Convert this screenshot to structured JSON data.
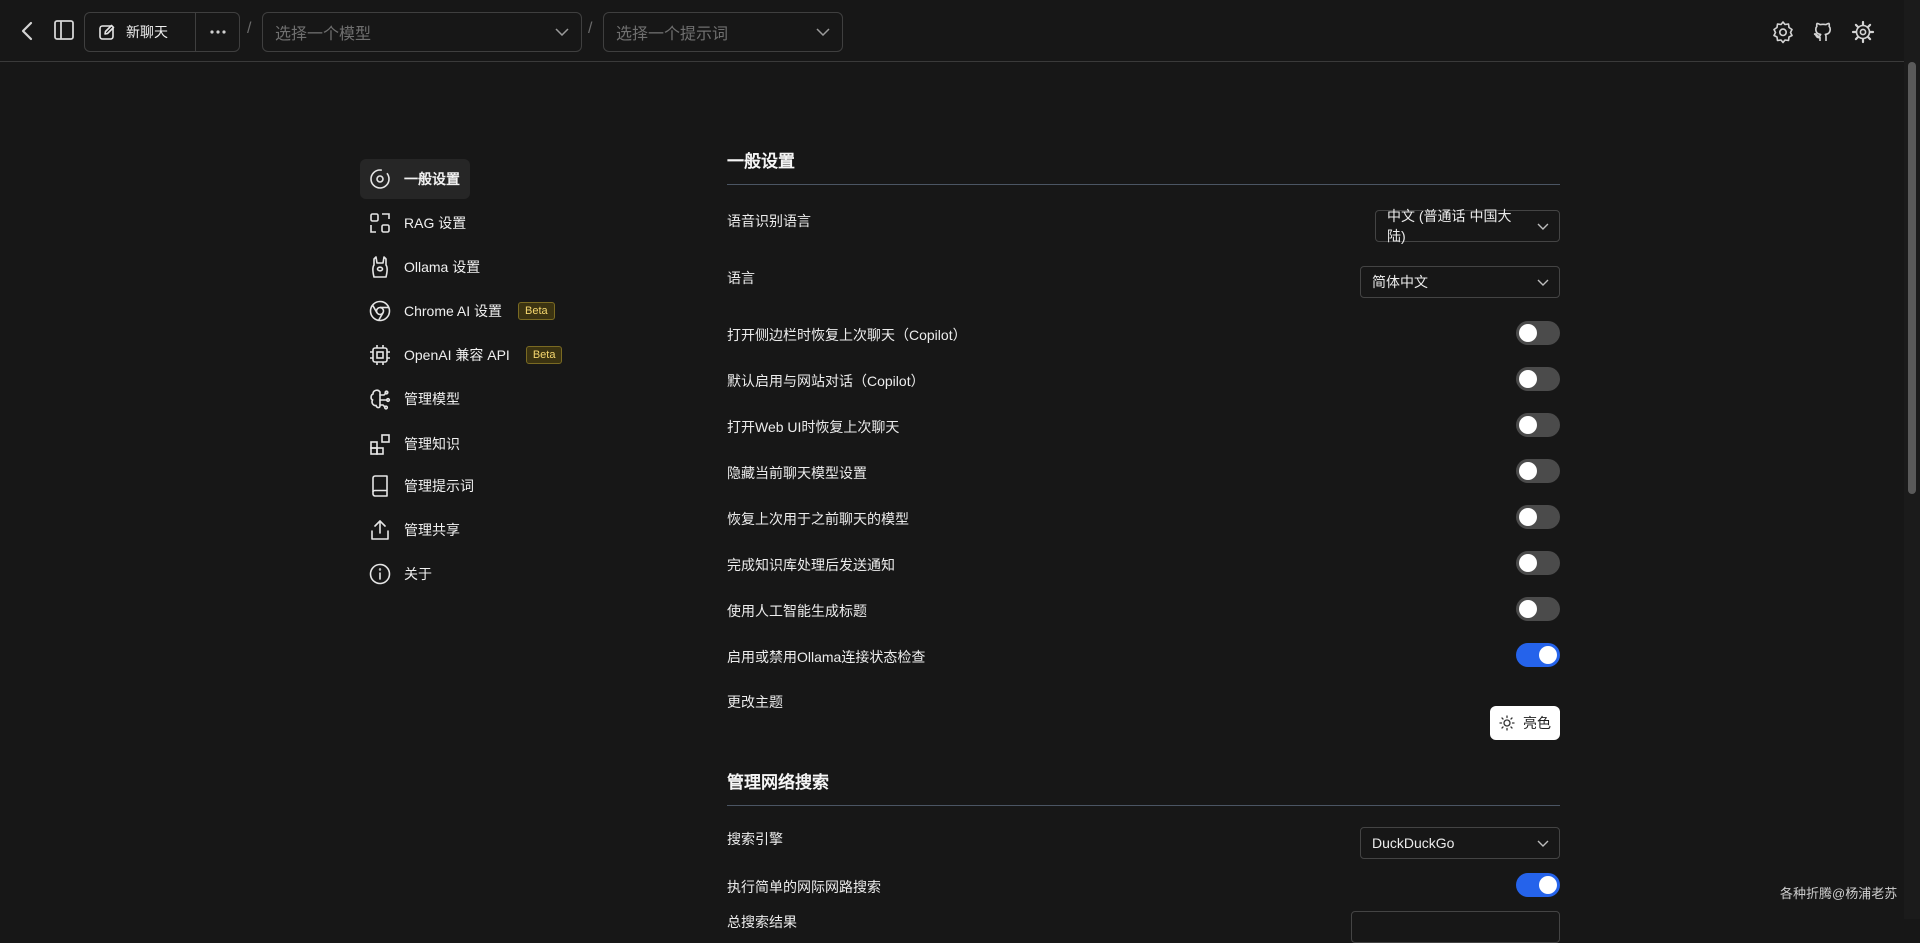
{
  "topbar": {
    "new_chat_label": "新聊天",
    "model_placeholder": "选择一个模型",
    "prompt_placeholder": "选择一个提示词",
    "separator": "/"
  },
  "sidebar": {
    "items": [
      {
        "label": "一般设置",
        "icon": "gear-circle-icon",
        "active": true
      },
      {
        "label": "RAG 设置",
        "icon": "scan-icon"
      },
      {
        "label": "Ollama 设置",
        "icon": "llama-icon"
      },
      {
        "label": "Chrome AI 设置",
        "icon": "chrome-icon",
        "badge": "Beta"
      },
      {
        "label": "OpenAI 兼容 API",
        "icon": "cpu-icon",
        "badge": "Beta"
      },
      {
        "label": "管理模型",
        "icon": "brain-icon"
      },
      {
        "label": "管理知识",
        "icon": "blocks-icon"
      },
      {
        "label": "管理提示词",
        "icon": "book-icon"
      },
      {
        "label": "管理共享",
        "icon": "share-icon"
      },
      {
        "label": "关于",
        "icon": "info-icon"
      }
    ]
  },
  "general": {
    "title": "一般设置",
    "speech_language_label": "语音识别语言",
    "speech_language_value": "中文 (普通话 中国大陆)",
    "language_label": "语言",
    "language_value": "简体中文",
    "toggles": [
      {
        "label": "打开侧边栏时恢复上次聊天（Copilot）",
        "on": false
      },
      {
        "label": "默认启用与网站对话（Copilot）",
        "on": false
      },
      {
        "label": "打开Web UI时恢复上次聊天",
        "on": false
      },
      {
        "label": "隐藏当前聊天模型设置",
        "on": false
      },
      {
        "label": "恢复上次用于之前聊天的模型",
        "on": false
      },
      {
        "label": "完成知识库处理后发送通知",
        "on": false
      },
      {
        "label": "使用人工智能生成标题",
        "on": false
      },
      {
        "label": "启用或禁用Ollama连接状态检查",
        "on": true
      }
    ],
    "theme_label": "更改主题",
    "theme_button": "亮色"
  },
  "web_search": {
    "title": "管理网络搜索",
    "engine_label": "搜索引擎",
    "engine_value": "DuckDuckGo",
    "simple_search_label": "执行简单的网际网路搜索",
    "simple_search_on": true,
    "partial_label": "总搜索结果"
  },
  "watermark": "各种折腾@杨浦老苏",
  "colors": {
    "accent": "#2563eb",
    "background": "#171717",
    "beta": "#f5d76e"
  }
}
